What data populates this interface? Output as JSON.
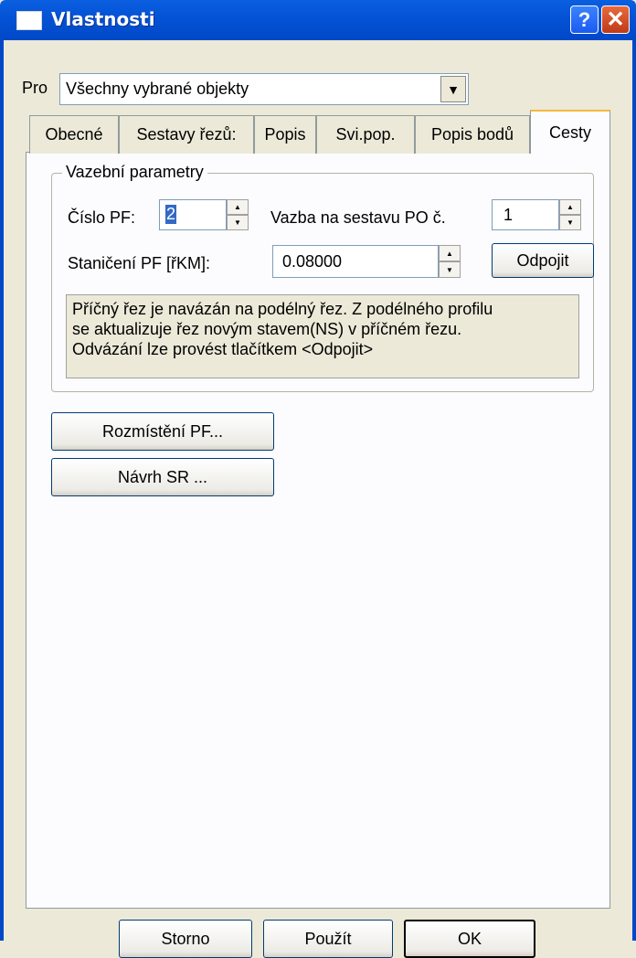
{
  "window": {
    "title": "Vlastnosti",
    "help": "?",
    "close": "✕"
  },
  "pro": {
    "label": "Pro",
    "value": "Všechny vybrané objekty"
  },
  "tabs": [
    "Obecné",
    "Sestavy řezů:",
    "Popis",
    "Svi.pop.",
    "Popis bodů",
    "Cesty"
  ],
  "group": {
    "title": "Vazební parametry",
    "cislo_label": "Číslo PF:",
    "cislo_value": "2",
    "vazba_label": "Vazba na sestavu PO č.",
    "vazba_value": "1",
    "staniceni_label": "Staničení PF [řKM]:",
    "staniceni_value": "0.08000",
    "odpojit": "Odpojit",
    "info": [
      "Příčný řez je navázán na podélný řez. Z podélného profilu",
      "se aktualizuje řez novým stavem(NS) v příčném řezu.",
      "Odvázání lze provést tlačítkem <Odpojit>"
    ]
  },
  "buttons": {
    "rozmisteni": "Rozmístění PF...",
    "navrh": "Návrh SR ..."
  },
  "footer": {
    "storno": "Storno",
    "pouzit": "Použít",
    "ok": "OK"
  }
}
